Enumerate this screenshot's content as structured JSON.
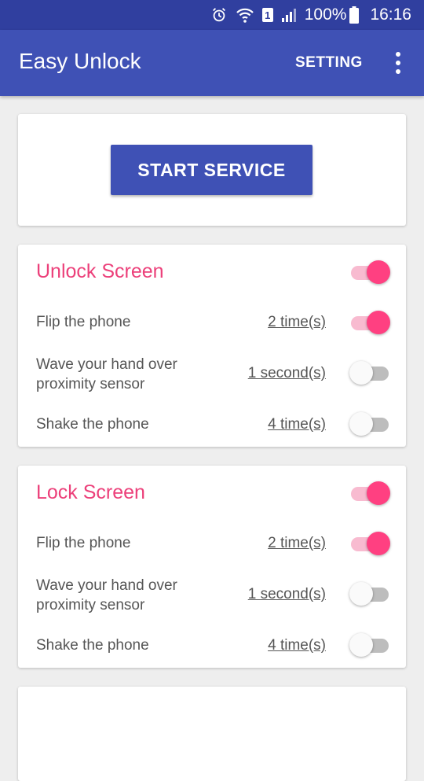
{
  "status_bar": {
    "sim_slot": "1",
    "battery_text": "100%",
    "time": "16:16",
    "icons": [
      "alarm-icon",
      "wifi-icon",
      "sim-icon",
      "signal-icon",
      "battery-icon"
    ]
  },
  "app_bar": {
    "title": "Easy Unlock",
    "setting_label": "SETTING",
    "overflow_icon": "more-vert-icon"
  },
  "service": {
    "button_label": "START SERVICE"
  },
  "unlock_section": {
    "title": "Unlock Screen",
    "enabled": true,
    "options": [
      {
        "label": "Flip the phone",
        "value": "2 time(s)",
        "enabled": true
      },
      {
        "label": "Wave your hand over\n proximity sensor",
        "value": "1 second(s)",
        "enabled": false
      },
      {
        "label": "Shake the phone",
        "value": "4 time(s)",
        "enabled": false
      }
    ]
  },
  "lock_section": {
    "title": "Lock Screen",
    "enabled": true,
    "options": [
      {
        "label": "Flip the phone",
        "value": "2 time(s)",
        "enabled": true
      },
      {
        "label": "Wave your hand over\n proximity sensor",
        "value": "1 second(s)",
        "enabled": false
      },
      {
        "label": "Shake the phone",
        "value": "4 time(s)",
        "enabled": false
      }
    ]
  },
  "colors": {
    "primary": "#3f51b5",
    "primary_dark": "#303f9f",
    "accent": "#ff4081",
    "section_title": "#ec407a"
  }
}
